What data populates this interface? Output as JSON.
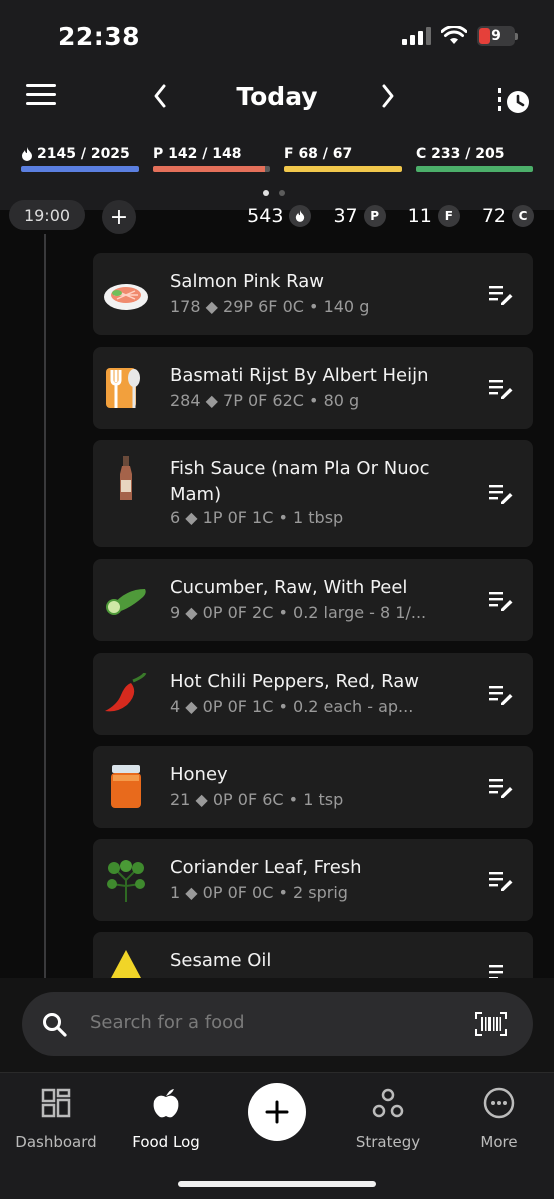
{
  "status": {
    "time": "22:38",
    "battery": "9"
  },
  "header": {
    "title": "Today"
  },
  "macros": [
    {
      "key": "calories",
      "label": "2145 / 2025",
      "color": "#5b7fe0",
      "progress": 1.0,
      "icon": true
    },
    {
      "key": "protein",
      "label": "P 142 / 148",
      "color": "#e4705a",
      "progress": 0.96
    },
    {
      "key": "fat",
      "label": "F 68 / 67",
      "color": "#f1c74c",
      "progress": 1.0
    },
    {
      "key": "carbs",
      "label": "C 233 / 205",
      "color": "#4caf6a",
      "progress": 1.0
    }
  ],
  "meal": {
    "time": "19:00",
    "calories": "543",
    "protein": "37",
    "protein_badge": "P",
    "fat": "11",
    "fat_badge": "F",
    "carbs": "72",
    "carbs_badge": "C"
  },
  "foods": [
    {
      "name": "Salmon Pink Raw",
      "cal": "178",
      "macros": "29P   6F   0C",
      "amount": "140 g",
      "icon": "salmon-icon"
    },
    {
      "name": "Basmati Rijst By Albert Heijn",
      "cal": "284",
      "macros": "7P   0F   62C",
      "amount": "80 g",
      "icon": "cutlery-icon"
    },
    {
      "name": "Fish Sauce (nam Pla Or Nuoc Mam)",
      "cal": "6",
      "macros": "1P   0F   1C",
      "amount": "1 tbsp",
      "icon": "bottle-icon"
    },
    {
      "name": "Cucumber, Raw, With Peel",
      "cal": "9",
      "macros": "0P   0F   2C",
      "amount": "0.2 large - 8 1/...",
      "icon": "cucumber-icon"
    },
    {
      "name": "Hot Chili Peppers, Red, Raw",
      "cal": "4",
      "macros": "0P   0F   1C",
      "amount": "0.2 each - ap...",
      "icon": "chili-icon"
    },
    {
      "name": "Honey",
      "cal": "21",
      "macros": "0P   0F   6C",
      "amount": "1 tsp",
      "icon": "honey-jar-icon"
    },
    {
      "name": "Coriander Leaf, Fresh",
      "cal": "1",
      "macros": "0P   0F   0C",
      "amount": "2 sprig",
      "icon": "herb-icon"
    },
    {
      "name": "Sesame Oil",
      "cal": "",
      "macros": "",
      "amount": "",
      "icon": "oil-drop-icon"
    }
  ],
  "search": {
    "placeholder": "Search for a food"
  },
  "tabs": [
    {
      "label": "Dashboard",
      "icon": "dashboard-icon"
    },
    {
      "label": "Food Log",
      "icon": "apple-icon"
    },
    {
      "label": "Strategy",
      "icon": "strategy-icon"
    },
    {
      "label": "More",
      "icon": "more-icon"
    }
  ]
}
